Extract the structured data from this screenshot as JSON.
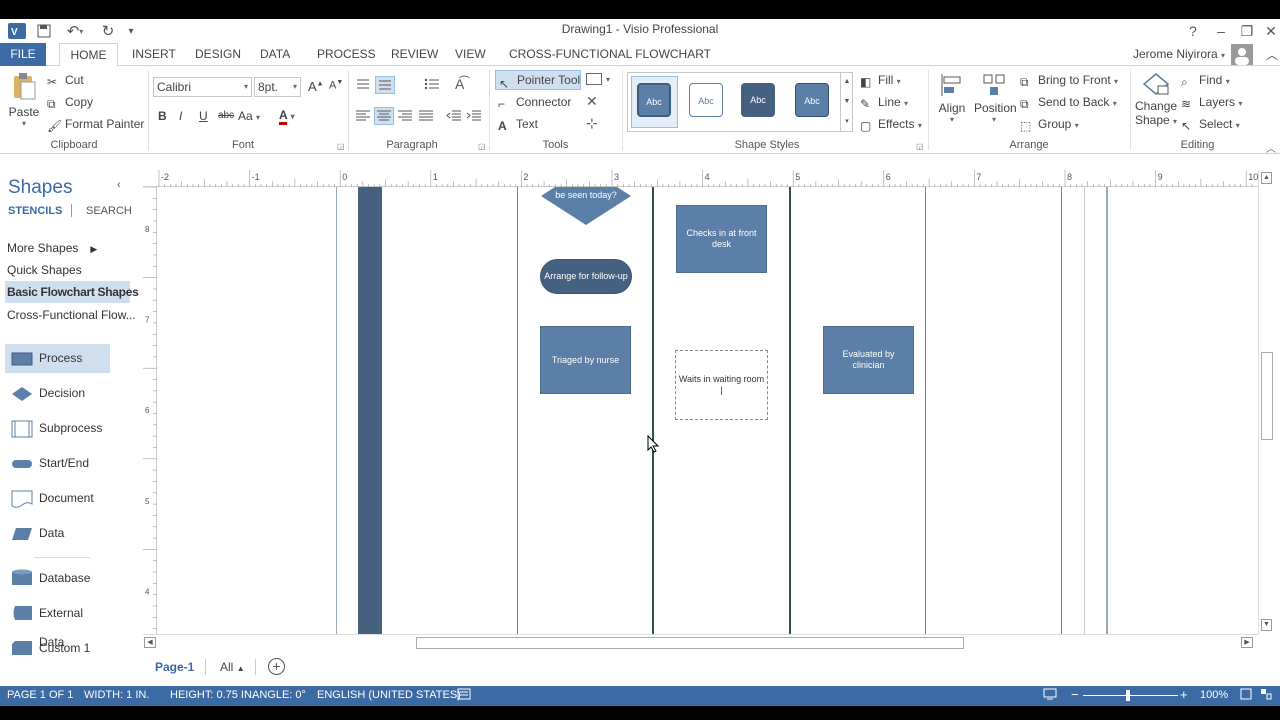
{
  "window": {
    "title": "Drawing1 - Visio Professional",
    "user": "Jerome Niyirora",
    "help": "?"
  },
  "tabs": [
    "FILE",
    "HOME",
    "INSERT",
    "DESIGN",
    "DATA",
    "PROCESS",
    "REVIEW",
    "VIEW",
    "CROSS-FUNCTIONAL FLOWCHART"
  ],
  "ribbon": {
    "clipboard": {
      "paste": "Paste",
      "cut": "Cut",
      "copy": "Copy",
      "format_painter": "Format Painter",
      "label": "Clipboard"
    },
    "font": {
      "family": "Calibri",
      "size": "8pt.",
      "label": "Font",
      "bold": "B",
      "italic": "I",
      "underline": "U",
      "strike": "abc",
      "case": "Aa",
      "color": "A"
    },
    "paragraph": {
      "label": "Paragraph"
    },
    "tools": {
      "pointer": "Pointer Tool",
      "connector": "Connector",
      "text": "Text",
      "label": "Tools"
    },
    "shape_styles": {
      "label": "Shape Styles",
      "swatch_text": "Abc",
      "fill": "Fill",
      "line": "Line",
      "effects": "Effects"
    },
    "arrange": {
      "align": "Align",
      "position": "Position",
      "bring_front": "Bring to Front",
      "send_back": "Send to Back",
      "group": "Group",
      "label": "Arrange"
    },
    "editing": {
      "change_shape_1": "Change",
      "change_shape_2": "Shape",
      "find": "Find",
      "layers": "Layers",
      "select": "Select",
      "label": "Editing"
    }
  },
  "shapes_pane": {
    "title": "Shapes",
    "stencils": "STENCILS",
    "search": "SEARCH",
    "links": [
      "More Shapes",
      "Quick Shapes",
      "Basic Flowchart Shapes",
      "Cross-Functional Flow..."
    ],
    "items": [
      "Process",
      "Decision",
      "Subprocess",
      "Start/End",
      "Document",
      "Data",
      "Database",
      "External Data",
      "Custom 1"
    ]
  },
  "ruler": {
    "h": [
      "-2",
      "-1",
      "0",
      "1",
      "2",
      "3",
      "4",
      "5",
      "6",
      "7",
      "8",
      "9",
      "10"
    ],
    "v": [
      "8",
      "7",
      "6",
      "5",
      "4"
    ]
  },
  "diagram": {
    "decision_partial": "Patient needs to be seen today?",
    "arrange_followup": "Arrange for follow-up",
    "checks_in": "Checks in at front desk",
    "triaged": "Triaged by nurse",
    "waits": "Waits in waiting room |",
    "evaluated": "Evaluated by clinician"
  },
  "pages": {
    "page1": "Page-1",
    "all": "All"
  },
  "status": {
    "page": "PAGE 1 OF 1",
    "width": "WIDTH: 1 IN.",
    "height": "HEIGHT: 0.75 IN.",
    "angle": "ANGLE: 0°",
    "language": "ENGLISH (UNITED STATES)",
    "zoom": "100%"
  },
  "colors": {
    "accent": "#3c6aa4",
    "shape_fill": "#5b7fa6",
    "lane_dark": "#2f5546",
    "pool_bar": "#44617f"
  }
}
